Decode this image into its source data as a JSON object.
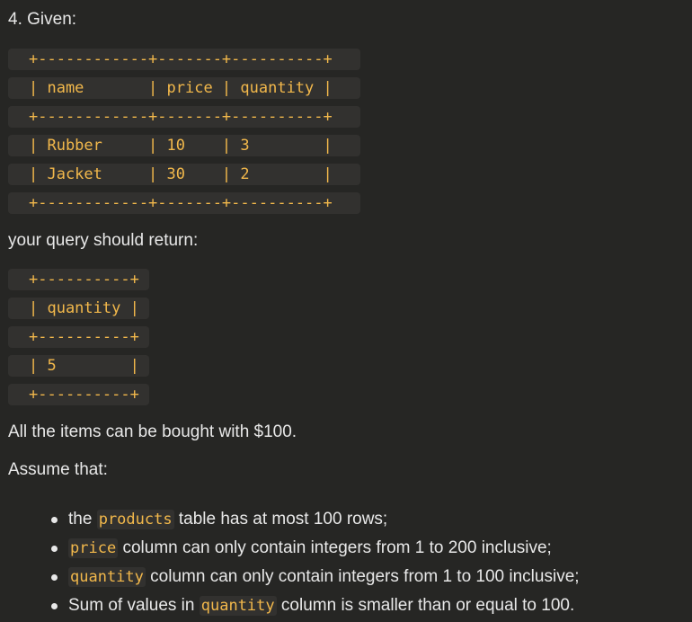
{
  "heading": "4. Given:",
  "given_table": [
    "+------------+-------+----------+",
    "| name       | price | quantity |",
    "+------------+-------+----------+",
    "| Rubber     | 10    | 3        |",
    "| Jacket     | 30    | 2        |",
    "+------------+-------+----------+"
  ],
  "query_intro": "your query should return:",
  "result_table": [
    "+----------+",
    "| quantity |",
    "+----------+",
    "| 5        |",
    "+----------+"
  ],
  "note": "All the items can be bought with $100.",
  "assume": "Assume that:",
  "bullets": [
    {
      "pre": "the ",
      "code": "products",
      "post": " table has at most 100 rows;"
    },
    {
      "pre": "",
      "code": "price",
      "post": " column can only contain integers from 1 to 200 inclusive;"
    },
    {
      "pre": "",
      "code": "quantity",
      "post": " column can only contain integers from 1 to 100 inclusive;"
    },
    {
      "pre": "Sum of values in ",
      "code": "quantity",
      "post": " column is smaller than or equal to 100."
    }
  ]
}
